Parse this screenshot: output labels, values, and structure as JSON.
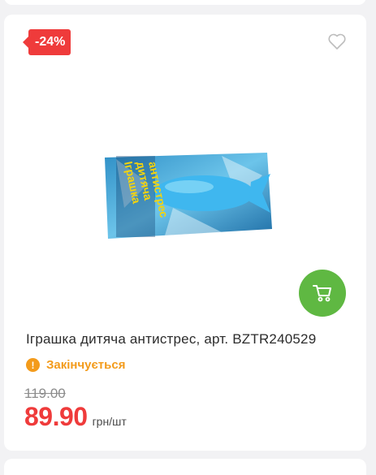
{
  "product": {
    "discount_badge": "-24%",
    "image_label_lines": [
      "Іграшка",
      "дитяча",
      "антистрес"
    ],
    "title": "Іграшка дитяча антистрес, арт. BZTR240529",
    "status": "Закінчується",
    "old_price": "119.00",
    "price": "89.90",
    "unit": "грн/шт"
  },
  "icons": {
    "wishlist": "heart-outline-icon",
    "cart": "shopping-cart-icon",
    "status": "warning-icon"
  },
  "colors": {
    "badge": "#ef3b3b",
    "price": "#ef3b3b",
    "cart_button": "#5fb842",
    "status": "#f39b1b"
  }
}
